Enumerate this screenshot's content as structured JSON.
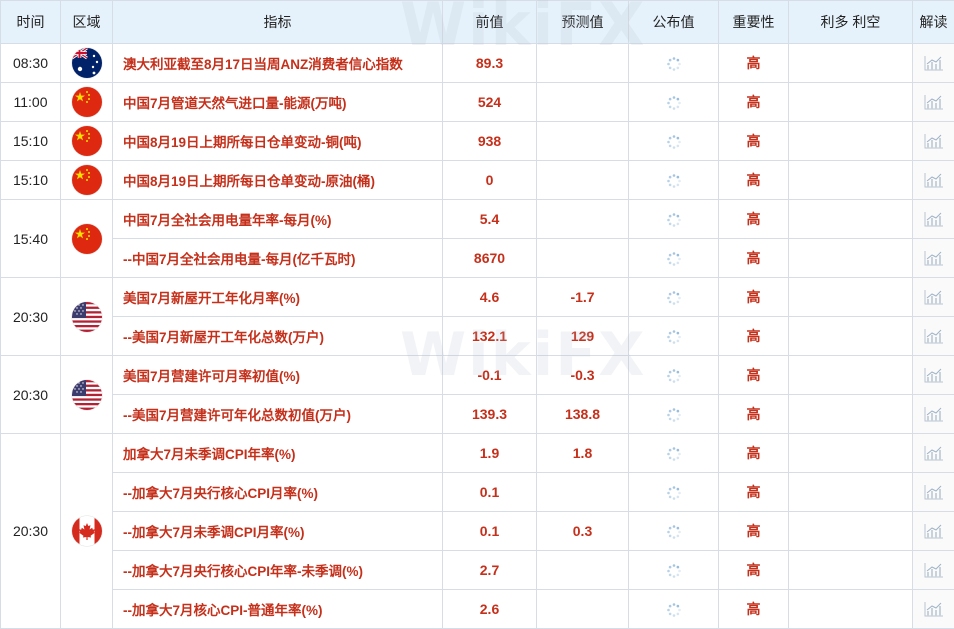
{
  "header": {
    "time": "时间",
    "region": "区域",
    "indicator": "指标",
    "previous": "前值",
    "forecast": "预测值",
    "published": "公布值",
    "importance": "重要性",
    "bullbear": "利多 利空",
    "interpret": "解读"
  },
  "watermark": "WikiFX",
  "groups": [
    {
      "time": "08:30",
      "country": "australia",
      "flag_icon": "australia-flag-icon",
      "rows": [
        {
          "indicator": "澳大利亚截至8月17日当周ANZ消费者信心指数",
          "previous": "89.3",
          "forecast": "",
          "importance": "高"
        }
      ]
    },
    {
      "time": "11:00",
      "country": "china",
      "flag_icon": "china-flag-icon",
      "rows": [
        {
          "indicator": "中国7月管道天然气进口量-能源(万吨)",
          "previous": "524",
          "forecast": "",
          "importance": "高"
        }
      ]
    },
    {
      "time": "15:10",
      "country": "china",
      "flag_icon": "china-flag-icon",
      "rows": [
        {
          "indicator": "中国8月19日上期所每日仓单变动-铜(吨)",
          "previous": "938",
          "forecast": "",
          "importance": "高"
        }
      ]
    },
    {
      "time": "15:10",
      "country": "china",
      "flag_icon": "china-flag-icon",
      "rows": [
        {
          "indicator": "中国8月19日上期所每日仓单变动-原油(桶)",
          "previous": "0",
          "forecast": "",
          "importance": "高"
        }
      ]
    },
    {
      "time": "15:40",
      "country": "china",
      "flag_icon": "china-flag-icon",
      "rows": [
        {
          "indicator": "中国7月全社会用电量年率-每月(%)",
          "previous": "5.4",
          "forecast": "",
          "importance": "高"
        },
        {
          "indicator": "--中国7月全社会用电量-每月(亿千瓦时)",
          "previous": "8670",
          "forecast": "",
          "importance": "高"
        }
      ]
    },
    {
      "time": "20:30",
      "country": "usa",
      "flag_icon": "usa-flag-icon",
      "rows": [
        {
          "indicator": "美国7月新屋开工年化月率(%)",
          "previous": "4.6",
          "forecast": "-1.7",
          "importance": "高"
        },
        {
          "indicator": "--美国7月新屋开工年化总数(万户)",
          "previous": "132.1",
          "forecast": "129",
          "importance": "高"
        }
      ]
    },
    {
      "time": "20:30",
      "country": "usa",
      "flag_icon": "usa-flag-icon",
      "rows": [
        {
          "indicator": "美国7月营建许可月率初值(%)",
          "previous": "-0.1",
          "forecast": "-0.3",
          "importance": "高"
        },
        {
          "indicator": "--美国7月营建许可年化总数初值(万户)",
          "previous": "139.3",
          "forecast": "138.8",
          "importance": "高"
        }
      ]
    },
    {
      "time": "20:30",
      "country": "canada",
      "flag_icon": "canada-flag-icon",
      "rows": [
        {
          "indicator": "加拿大7月未季调CPI年率(%)",
          "previous": "1.9",
          "forecast": "1.8",
          "importance": "高"
        },
        {
          "indicator": "--加拿大7月央行核心CPI月率(%)",
          "previous": "0.1",
          "forecast": "",
          "importance": "高"
        },
        {
          "indicator": "--加拿大7月未季调CPI月率(%)",
          "previous": "0.1",
          "forecast": "0.3",
          "importance": "高"
        },
        {
          "indicator": "--加拿大7月央行核心CPI年率-未季调(%)",
          "previous": "2.7",
          "forecast": "",
          "importance": "高"
        },
        {
          "indicator": "--加拿大7月核心CPI-普通年率(%)",
          "previous": "2.6",
          "forecast": "",
          "importance": "高"
        }
      ]
    }
  ],
  "colors": {
    "header_bg": "#e6f2fb",
    "accent_red": "#c5301b",
    "border": "#d6dde6"
  }
}
